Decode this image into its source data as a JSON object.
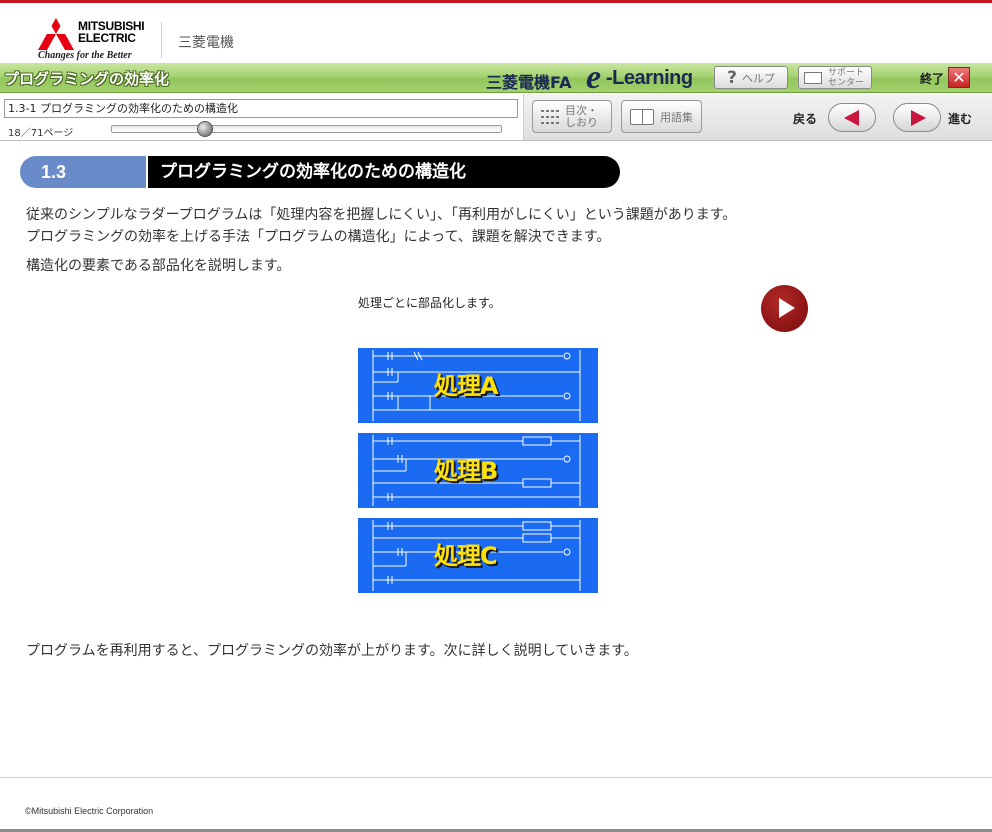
{
  "brand": {
    "company_name": "MITSUBISHI\nELECTRIC",
    "tagline": "Changes for the Better",
    "jp_name": "三菱電機"
  },
  "title_bar": {
    "course_title": "プログラミングの効率化",
    "brand_fa": "三菱電機FA",
    "brand_e": "e",
    "brand_learning": "-Learning",
    "help_label": "ヘルプ",
    "support_label": "サポート\nセンター",
    "exit_label": "終了"
  },
  "nav": {
    "page_title": "1.3-1 プログラミングの効率化のための構造化",
    "page_counter": "18／71ページ",
    "progress": 0.24,
    "toc_label": "目次・\nしおり",
    "glossary_label": "用語集",
    "back_label": "戻る",
    "next_label": "進む"
  },
  "section": {
    "number": "1.3",
    "title": "プログラミングの効率化のための構造化"
  },
  "content": {
    "paragraph_1": "従来のシンプルなラダープログラムは「処理内容を把握しにくい」、「再利用がしにくい」という課題があります。",
    "paragraph_2": "プログラミングの効率を上げる手法「プログラムの構造化」によって、課題を解決できます。",
    "paragraph_3": "構造化の要素である部品化を説明します。",
    "caption": "処理ごとに部品化します。",
    "blocks": [
      "処理A",
      "処理B",
      "処理C"
    ],
    "conclusion": "プログラムを再利用すると、プログラミングの効率が上がります。次に詳しく説明していきます。"
  },
  "footer": {
    "copyright": "©Mitsubishi Electric Corporation"
  },
  "colors": {
    "accent_red": "#c8161d",
    "title_bar_green": "#a6d372",
    "section_blue": "#6a8bc9",
    "block_blue": "#1a6af2",
    "block_label_yellow": "#ffe10a",
    "play_red": "#8b0f0f"
  },
  "icons": [
    "mitsubishi-logo-icon",
    "help-icon",
    "mail-icon",
    "close-icon",
    "list-icon",
    "book-icon",
    "arrow-left-icon",
    "arrow-right-icon",
    "play-icon"
  ]
}
